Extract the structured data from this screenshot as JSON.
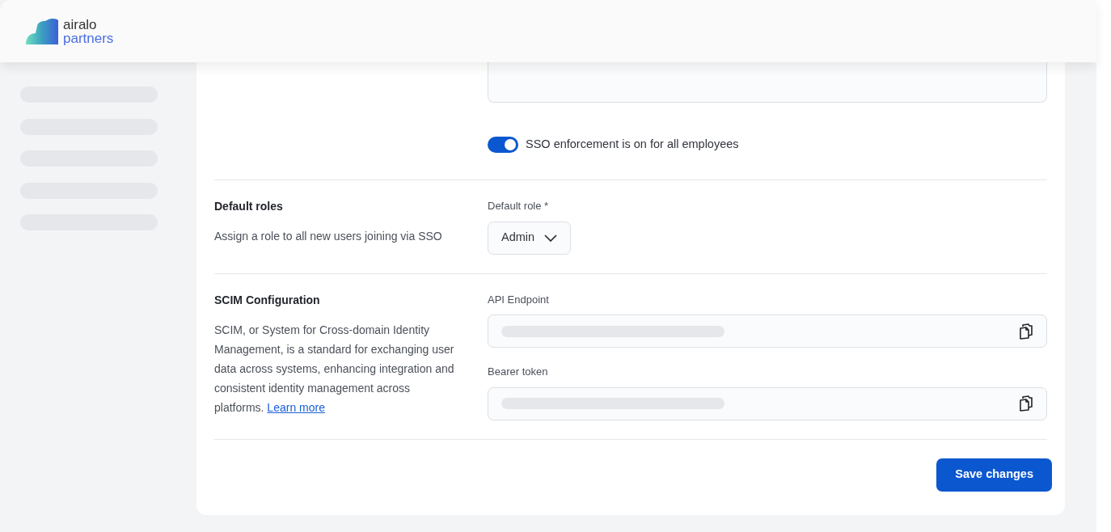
{
  "header": {
    "logo": {
      "line_1": "airalo",
      "line_2": "partners"
    }
  },
  "sso": {
    "toggle": {
      "on": true,
      "label": "SSO enforcement is on for all employees"
    }
  },
  "sections": [
    {
      "kind": "select",
      "title": "Default roles",
      "description": "Assign a role to all new users joining via SSO",
      "field_label": "Default role",
      "required_mark": "*",
      "value": "Admin"
    },
    {
      "kind": "fields",
      "title": "SCIM Configuration",
      "description": "SCIM, or System for Cross-domain Identity Management, is a standard for exchanging user data across systems, enhancing integration and consistent identity management across platforms.",
      "link": "Learn more",
      "fields": [
        {
          "label": "API Endpoint"
        },
        {
          "label": "Bearer token"
        }
      ]
    }
  ],
  "save_button": "Save changes"
}
